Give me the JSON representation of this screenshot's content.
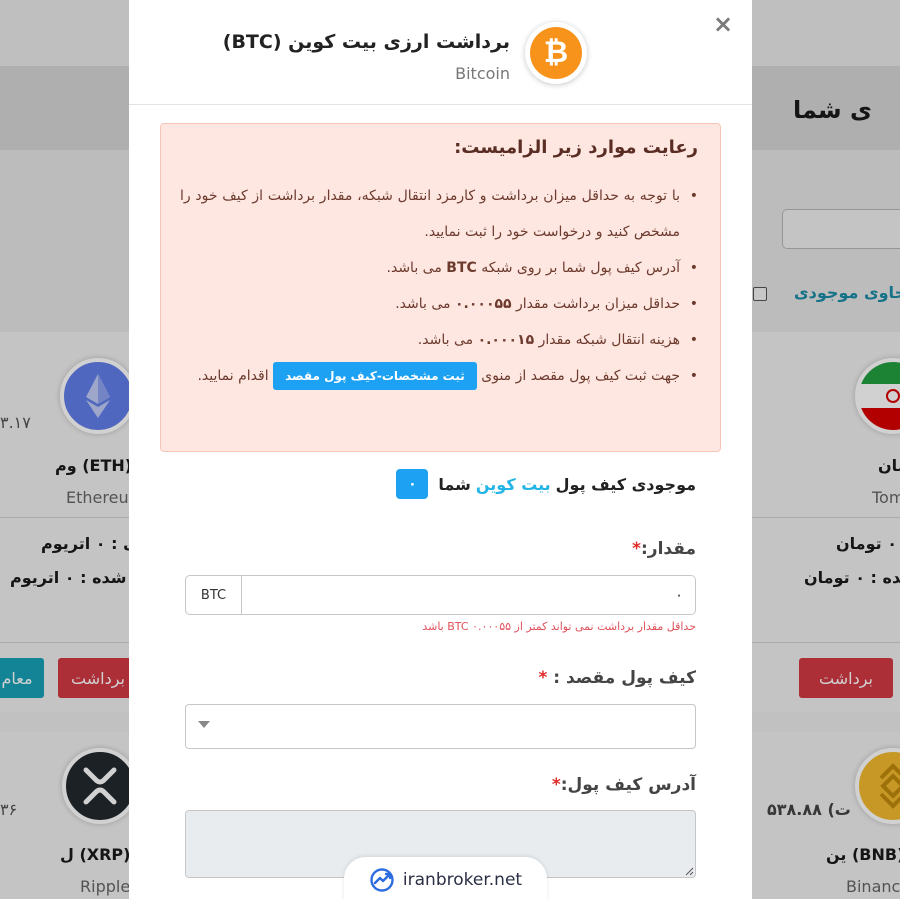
{
  "background": {
    "page_title": "ی شما",
    "checkbox_label": "حاوی موجودی",
    "cards": {
      "eth": {
        "value_edge": "۳.۱۷",
        "name": "وم (ETH)",
        "english": "Ethereu",
        "line1": "دی : ۰ اتریوم",
        "line2": "ریز شده : ۰ اتریوم",
        "withdraw": "برداشت",
        "trade": "معام"
      },
      "toman": {
        "name": "مان",
        "english": "Tom",
        "line1": ": ۰ تومان",
        "line2": "شده : ۰ تومان",
        "withdraw": "برداشت"
      },
      "xrp": {
        "value_edge": "۳۶",
        "name": "ل (XRP)",
        "english": "Ripple"
      },
      "bnb": {
        "value_edge": "۵۳۸.۸۸ (ت",
        "name": "ین (BNB)",
        "english": "Binanc"
      }
    }
  },
  "modal": {
    "title": "برداشت ارزی بیت کوین (BTC)",
    "subtitle": "Bitcoin",
    "close": "×",
    "logo_letter": "₿",
    "notice": {
      "heading": "رعایت موارد زیر الزامیست:",
      "item1": "با توجه به حداقل میزان برداشت و کارمزد انتقال شبکه، مقدار برداشت از کیف خود را مشخص کنید و درخواست خود را ثبت نمایید.",
      "item2_before": "آدرس کیف پول شما بر روی شبکه",
      "item2_bold": "BTC",
      "item2_after": "می باشد.",
      "item3_before": "حداقل میزان برداشت مقدار",
      "item3_bold": "۰.۰۰۰۵۵",
      "item3_after": "می باشد.",
      "item4_before": "هزینه انتقال شبکه مقدار",
      "item4_bold": "۰.۰۰۰۱۵",
      "item4_after": "می باشد.",
      "item5_before": "جهت ثبت کیف پول مقصد از منوی",
      "item5_button": "ثبت مشخصات-کیف پول مقصد",
      "item5_after": "اقدام نمایید."
    },
    "balance": {
      "before": "موجودی کیف پول",
      "highlight": "بیت کوین",
      "after": "شما",
      "value": "۰"
    },
    "amount": {
      "label": "مقدار:",
      "required": "*",
      "unit": "BTC",
      "value": "۰",
      "hint": "حداقل مقدار برداشت نمی تواند کمتر از ۰.۰۰۰۵۵ BTC باشد"
    },
    "destination_wallet": {
      "label": "کیف پول مقصد :",
      "required": "*"
    },
    "wallet_address": {
      "label": "آدرس کیف پول:",
      "required": "*"
    }
  },
  "watermark": {
    "text": "iranbroker.net"
  },
  "colors": {
    "bitcoin": "#f7931a",
    "accent": "#1da1f2",
    "danger": "#d23a45",
    "alert_bg": "#fde7e0"
  }
}
